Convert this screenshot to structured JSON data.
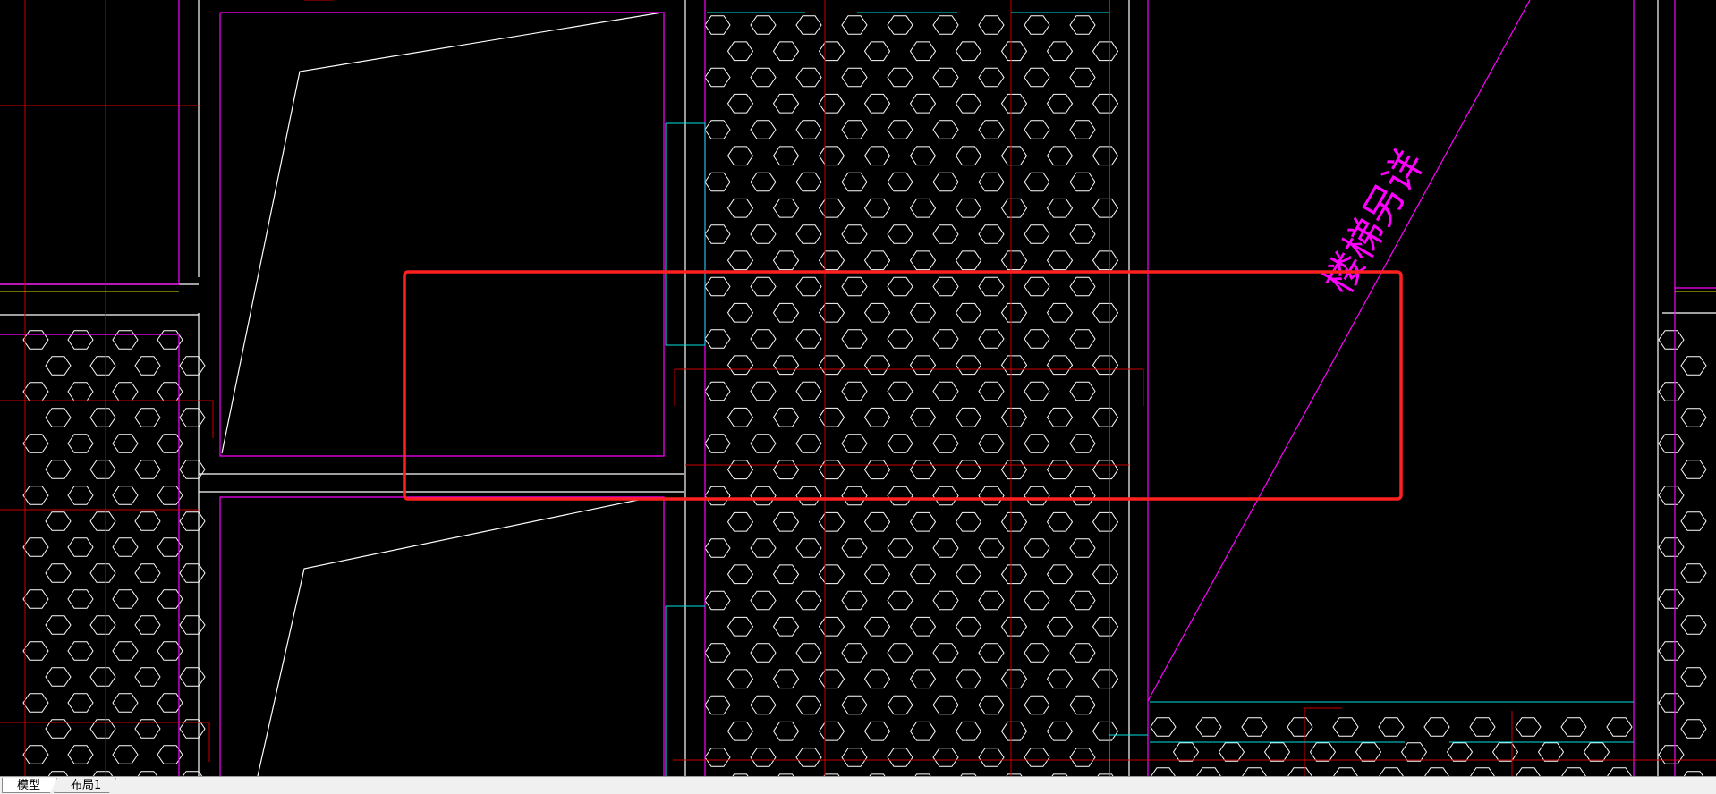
{
  "drawing": {
    "annotation_text": "楼梯另详"
  },
  "tabs": [
    {
      "label": "模型",
      "active": true
    },
    {
      "label": "布局1",
      "active": false
    }
  ],
  "colors": {
    "background": "#000000",
    "white_lines": "#ffffff",
    "magenta_lines": "#ff00ff",
    "red_lines": "#ff0000",
    "cyan_lines": "#00ffff",
    "yellow_lines": "#ffff00",
    "highlight_box": "#ff2a2a"
  }
}
